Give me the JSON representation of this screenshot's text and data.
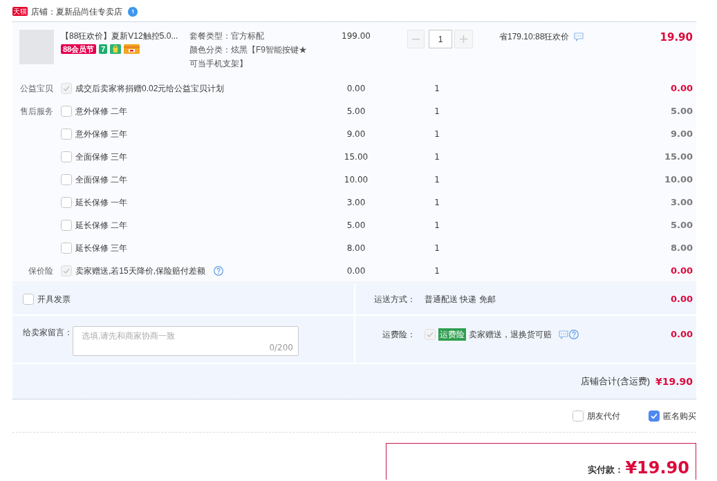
{
  "shop": {
    "logo": "天猫",
    "name": "店铺：夏新品尚佳专卖店"
  },
  "product": {
    "title": "【88狂欢价】夏新V12触控5.0...",
    "badges": [
      {
        "text": "88会员节",
        "color": "#e5004f"
      },
      {
        "text": "7",
        "color": "#1fae6e"
      }
    ],
    "sku": [
      "套餐类型：官方标配",
      "颜色分类：炫黑【F9智能按键★可当手机支架】"
    ],
    "price": "199.00",
    "quantity": "1",
    "savings": "省179.10:88狂欢价",
    "total": "19.90"
  },
  "services": [
    {
      "group": "公益宝贝",
      "label": "成交后卖家将捐赠0.02元给公益宝贝计划",
      "checked": true,
      "disabled": true,
      "help": false,
      "price": "0.00",
      "quantity": "1",
      "total": "0.00"
    },
    {
      "group": "售后服务",
      "label": "意外保修 二年",
      "checked": false,
      "disabled": false,
      "help": false,
      "price": "5.00",
      "quantity": "1",
      "total": "5.00"
    },
    {
      "label": "意外保修 三年",
      "checked": false,
      "disabled": false,
      "help": false,
      "price": "9.00",
      "quantity": "1",
      "total": "9.00"
    },
    {
      "label": "全面保修 三年",
      "checked": false,
      "disabled": false,
      "help": false,
      "price": "15.00",
      "quantity": "1",
      "total": "15.00"
    },
    {
      "label": "全面保修 二年",
      "checked": false,
      "disabled": false,
      "help": false,
      "price": "10.00",
      "quantity": "1",
      "total": "10.00"
    },
    {
      "label": "延长保修 一年",
      "checked": false,
      "disabled": false,
      "help": false,
      "price": "3.00",
      "quantity": "1",
      "total": "3.00"
    },
    {
      "label": "延长保修 二年",
      "checked": false,
      "disabled": false,
      "help": false,
      "price": "5.00",
      "quantity": "1",
      "total": "5.00"
    },
    {
      "label": "延长保修 三年",
      "checked": false,
      "disabled": false,
      "help": false,
      "price": "8.00",
      "quantity": "1",
      "total": "8.00"
    },
    {
      "group": "保价险",
      "label": "卖家赠送,若15天降价,保险赔付差额",
      "checked": true,
      "disabled": true,
      "help": true,
      "price": "0.00",
      "quantity": "1",
      "total": "0.00"
    }
  ],
  "invoice": {
    "label": "开具发票",
    "checked": false
  },
  "shipping": {
    "label": "运送方式：",
    "value": "普通配送 快递 免邮",
    "total": "0.00"
  },
  "message": {
    "label": "给卖家留言：",
    "placeholder": "选填,请先和商家协商一致",
    "counter": "0/200"
  },
  "freight_insurance": {
    "label": "运费险：",
    "checked": true,
    "disabled": true,
    "badge": "运费险",
    "text": "卖家赠送，退换货可赔",
    "total": "0.00"
  },
  "shop_total": {
    "label": "店铺合计(含运费)",
    "value": "¥19.90"
  },
  "options": [
    {
      "label": "朋友代付",
      "checked": false
    },
    {
      "label": "匿名购买",
      "checked": true
    }
  ],
  "payment": {
    "label": "实付款：",
    "value": "¥19.90"
  }
}
